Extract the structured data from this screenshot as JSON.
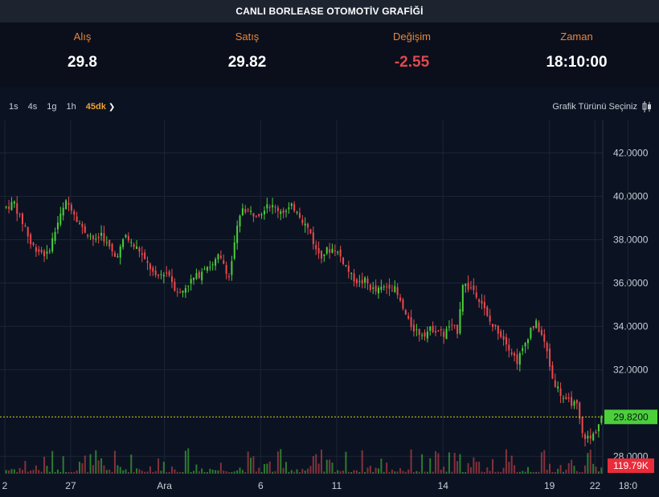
{
  "header": {
    "title": "CANLI BORLEASE OTOMOTİV GRAFİĞİ"
  },
  "quote": {
    "bid_label": "Alış",
    "bid_value": "29.8",
    "ask_label": "Satış",
    "ask_value": "29.82",
    "change_label": "Değişim",
    "change_value": "-2.55",
    "time_label": "Zaman",
    "time_value": "18:10:00"
  },
  "toolbar": {
    "timeframes": [
      "1s",
      "4s",
      "1g",
      "1h",
      "45dk"
    ],
    "active_timeframe": "45dk",
    "chart_type_label": "Grafik Türünü Seçiniz",
    "chart_type_icon": "candlestick-icon"
  },
  "colors": {
    "up": "#4ccf3a",
    "down": "#ea4a4e",
    "price_line": "#d6d60a",
    "price_label_bg": "#4ccf3a",
    "volume_label_bg": "#ea2c3a",
    "accent": "#e8873a"
  },
  "chart_data": {
    "type": "candlestick",
    "ylim": [
      27.2,
      43.5
    ],
    "y_ticks": [
      "42.0000",
      "40.0000",
      "38.0000",
      "36.0000",
      "34.0000",
      "32.0000",
      "28.0000"
    ],
    "x_ticks": [
      "2",
      "27",
      "Ara",
      "6",
      "11",
      "14",
      "19",
      "22",
      "18:0"
    ],
    "last_price_label": "29.8200",
    "last_price": 29.82,
    "volume_label": "119.79K",
    "grid": true,
    "close_path": [
      [
        0,
        39.5
      ],
      [
        3,
        39.7
      ],
      [
        5,
        39.0
      ],
      [
        7,
        38.6
      ],
      [
        9,
        37.8
      ],
      [
        12,
        37.5
      ],
      [
        15,
        37.3
      ],
      [
        17,
        38.0
      ],
      [
        19,
        38.8
      ],
      [
        22,
        39.7
      ],
      [
        24,
        39.5
      ],
      [
        26,
        39.0
      ],
      [
        28,
        38.5
      ],
      [
        31,
        38.2
      ],
      [
        33,
        37.9
      ],
      [
        35,
        38.3
      ],
      [
        37,
        37.8
      ],
      [
        40,
        37.2
      ],
      [
        42,
        37.6
      ],
      [
        44,
        38.2
      ],
      [
        46,
        37.8
      ],
      [
        49,
        37.5
      ],
      [
        51,
        37.0
      ],
      [
        53,
        36.7
      ],
      [
        55,
        36.2
      ],
      [
        58,
        36.5
      ],
      [
        60,
        36.4
      ],
      [
        62,
        35.8
      ],
      [
        64,
        35.5
      ],
      [
        67,
        36.0
      ],
      [
        69,
        36.2
      ],
      [
        71,
        36.4
      ],
      [
        73,
        36.8
      ],
      [
        76,
        36.8
      ],
      [
        78,
        37.2
      ],
      [
        80,
        36.9
      ],
      [
        82,
        36.3
      ],
      [
        85,
        38.5
      ],
      [
        87,
        39.5
      ],
      [
        89,
        39.3
      ],
      [
        91,
        39.2
      ],
      [
        94,
        39.3
      ],
      [
        96,
        39.7
      ],
      [
        98,
        39.5
      ],
      [
        100,
        39.4
      ],
      [
        103,
        39.3
      ],
      [
        105,
        39.5
      ],
      [
        107,
        39.4
      ],
      [
        109,
        38.9
      ],
      [
        112,
        38.3
      ],
      [
        114,
        37.5
      ],
      [
        116,
        37.3
      ],
      [
        118,
        37.5
      ],
      [
        121,
        37.6
      ],
      [
        123,
        37.2
      ],
      [
        125,
        36.8
      ],
      [
        127,
        36.3
      ],
      [
        130,
        36.0
      ],
      [
        132,
        36.1
      ],
      [
        134,
        35.8
      ],
      [
        136,
        35.6
      ],
      [
        139,
        35.8
      ],
      [
        141,
        35.9
      ],
      [
        143,
        35.7
      ],
      [
        145,
        35.1
      ],
      [
        148,
        34.2
      ],
      [
        150,
        33.9
      ],
      [
        152,
        33.7
      ],
      [
        154,
        33.7
      ],
      [
        157,
        33.9
      ],
      [
        159,
        33.8
      ],
      [
        161,
        33.6
      ],
      [
        163,
        34.0
      ],
      [
        166,
        33.8
      ],
      [
        168,
        36.0
      ],
      [
        170,
        35.8
      ],
      [
        172,
        35.7
      ],
      [
        175,
        35.1
      ],
      [
        177,
        34.4
      ],
      [
        179,
        34.0
      ],
      [
        181,
        33.8
      ],
      [
        184,
        33.3
      ],
      [
        186,
        32.8
      ],
      [
        188,
        32.4
      ],
      [
        190,
        32.9
      ],
      [
        193,
        33.9
      ],
      [
        195,
        34.1
      ],
      [
        197,
        33.6
      ],
      [
        199,
        32.8
      ],
      [
        201,
        31.6
      ],
      [
        204,
        30.9
      ],
      [
        206,
        30.5
      ],
      [
        208,
        30.5
      ],
      [
        210,
        30.3
      ],
      [
        212,
        29.0
      ],
      [
        215,
        28.8
      ],
      [
        217,
        29.2
      ],
      [
        219,
        29.82
      ]
    ],
    "n_candles": 220
  }
}
